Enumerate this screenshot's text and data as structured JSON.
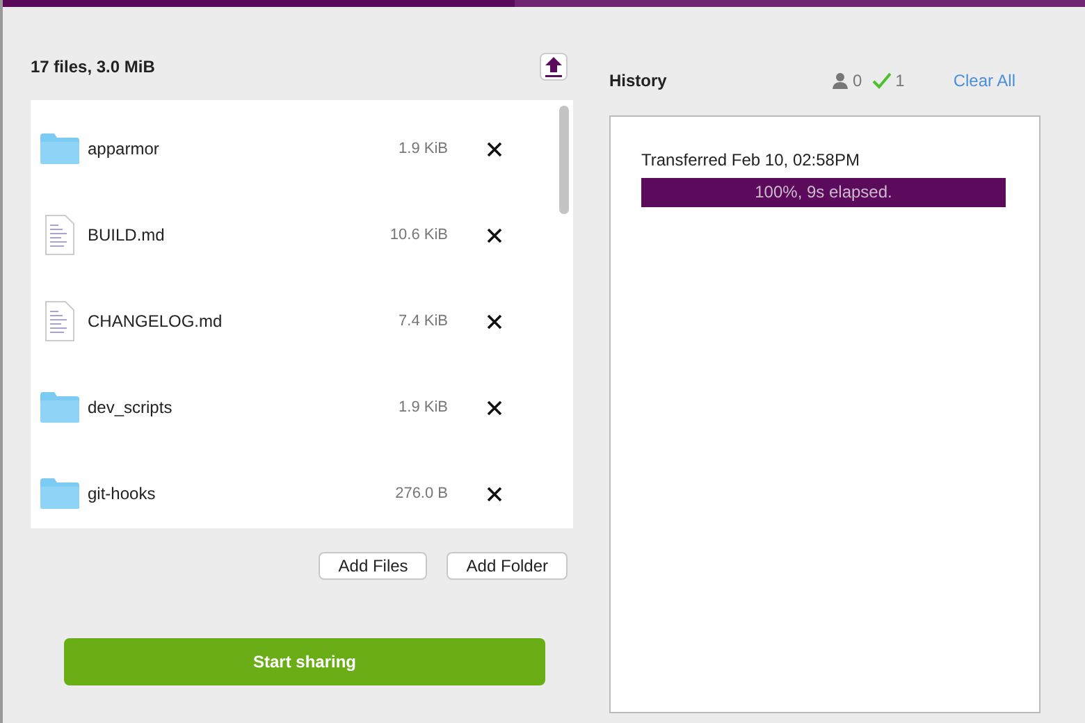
{
  "summary": "17 files, 3.0 MiB",
  "files": [
    {
      "kind": "folder",
      "name": "apparmor",
      "size": "1.9 KiB"
    },
    {
      "kind": "file",
      "name": "BUILD.md",
      "size": "10.6 KiB"
    },
    {
      "kind": "file",
      "name": "CHANGELOG.md",
      "size": "7.4 KiB"
    },
    {
      "kind": "folder",
      "name": "dev_scripts",
      "size": "1.9 KiB"
    },
    {
      "kind": "folder",
      "name": "git-hooks",
      "size": "276.0 B"
    }
  ],
  "buttons": [
    "Add Files",
    "Add Folder"
  ],
  "start_button": "Start sharing",
  "history": {
    "title": "History",
    "in_progress": "0",
    "completed": "1",
    "clear": "Clear All",
    "items": [
      {
        "title": "Transferred Feb 10, 02:58PM",
        "level": 1,
        "reading": "100%, 9s elapsed."
      }
    ]
  }
}
